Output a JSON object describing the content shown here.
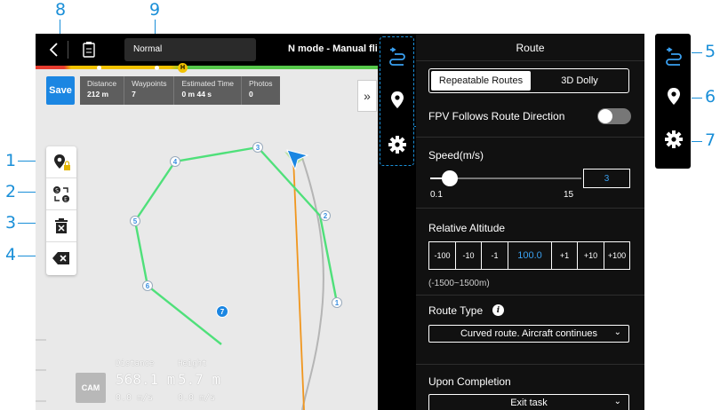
{
  "callouts": [
    "1",
    "2",
    "3",
    "4",
    "5",
    "6",
    "7",
    "8",
    "9"
  ],
  "topbar": {
    "back_icon": "chevron-left-icon",
    "checklist_icon": "clipboard-icon",
    "mode_dropdown": "Normal",
    "flight_mode": "N mode - Manual fli",
    "home_marker": "H"
  },
  "toolbar": {
    "save_label": "Save"
  },
  "stats": [
    {
      "label": "Distance",
      "value": "212 m"
    },
    {
      "label": "Waypoints",
      "value": "7"
    },
    {
      "label": "Estimated Time",
      "value": "0 m 44 s"
    },
    {
      "label": "Photos",
      "value": "0"
    }
  ],
  "expand_label": "»",
  "tools": [
    "add-waypoint-lock-icon",
    "reverse-route-icon",
    "delete-icon",
    "backspace-icon"
  ],
  "waypoints": [
    "1",
    "2",
    "3",
    "4",
    "5",
    "6",
    "7"
  ],
  "osd": {
    "cam_label": "CAM",
    "distance_label": "Distance",
    "height_label": "Height",
    "distance_value": "568.1 m",
    "height_value": "5.7 m",
    "speed1": "0.0 m/s",
    "speed2": "0.0 m/s"
  },
  "panel": {
    "title": "Route",
    "tab_repeatable": "Repeatable Routes",
    "tab_dolly": "3D Dolly",
    "fpv_label": "FPV Follows Route Direction",
    "speed_label": "Speed(m/s)",
    "speed_value": "3",
    "speed_min": "0.1",
    "speed_max": "15",
    "speed_fraction": 0.13,
    "altitude_label": "Relative Altitude",
    "altitude_buttons": [
      "-100",
      "-10",
      "-1",
      "100.0",
      "+1",
      "+10",
      "+100"
    ],
    "altitude_range": "(-1500~1500m)",
    "route_type_label": "Route Type",
    "route_type_value": "Curved route. Aircraft continues",
    "completion_label": "Upon Completion",
    "completion_value": "Exit task"
  },
  "colors": {
    "accent": "#1b86e2",
    "route": "#4fe07a",
    "heading": "#f0961e"
  }
}
